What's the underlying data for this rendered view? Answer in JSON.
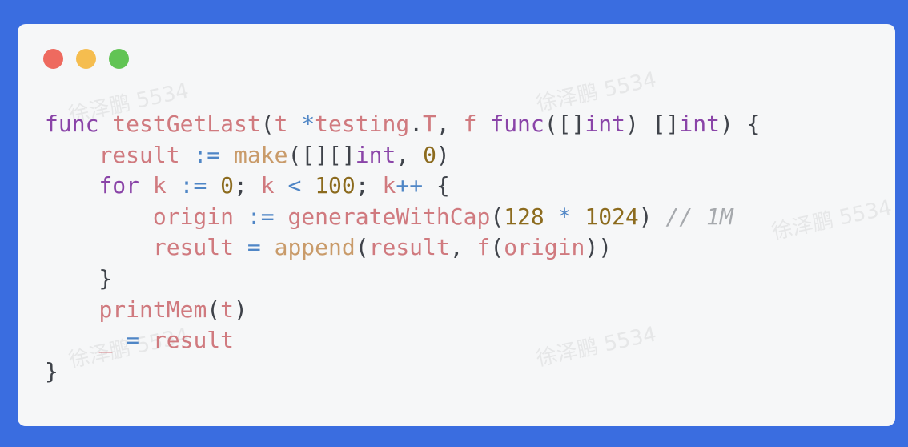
{
  "window": {
    "controls": [
      "close",
      "minimize",
      "maximize"
    ],
    "colors": {
      "close": "#ee6a5f",
      "minimize": "#f5bd4f",
      "maximize": "#61c454",
      "background": "#3a6de0",
      "card": "#f6f7f8"
    }
  },
  "watermark": "徐泽鹏 5534",
  "code": {
    "lines": [
      [
        [
          "kw",
          "func"
        ],
        [
          "pu",
          " "
        ],
        [
          "fn",
          "testGetLast"
        ],
        [
          "pu",
          "("
        ],
        [
          "id",
          "t"
        ],
        [
          "pu",
          " "
        ],
        [
          "op",
          "*"
        ],
        [
          "id",
          "testing"
        ],
        [
          "pu",
          "."
        ],
        [
          "id",
          "T"
        ],
        [
          "pu",
          ", "
        ],
        [
          "id",
          "f"
        ],
        [
          "pu",
          " "
        ],
        [
          "kw",
          "func"
        ],
        [
          "pu",
          "([]"
        ],
        [
          "kw",
          "int"
        ],
        [
          "pu",
          ") []"
        ],
        [
          "kw",
          "int"
        ],
        [
          "pu",
          ") {"
        ]
      ],
      [
        [
          "pu",
          "    "
        ],
        [
          "id",
          "result"
        ],
        [
          "pu",
          " "
        ],
        [
          "op",
          ":="
        ],
        [
          "pu",
          " "
        ],
        [
          "bi",
          "make"
        ],
        [
          "pu",
          "([][]"
        ],
        [
          "kw",
          "int"
        ],
        [
          "pu",
          ", "
        ],
        [
          "num",
          "0"
        ],
        [
          "pu",
          ")"
        ]
      ],
      [
        [
          "pu",
          "    "
        ],
        [
          "kw",
          "for"
        ],
        [
          "pu",
          " "
        ],
        [
          "id",
          "k"
        ],
        [
          "pu",
          " "
        ],
        [
          "op",
          ":="
        ],
        [
          "pu",
          " "
        ],
        [
          "num",
          "0"
        ],
        [
          "pu",
          "; "
        ],
        [
          "id",
          "k"
        ],
        [
          "pu",
          " "
        ],
        [
          "op",
          "<"
        ],
        [
          "pu",
          " "
        ],
        [
          "num",
          "100"
        ],
        [
          "pu",
          "; "
        ],
        [
          "id",
          "k"
        ],
        [
          "op",
          "++"
        ],
        [
          "pu",
          " {"
        ]
      ],
      [
        [
          "pu",
          "        "
        ],
        [
          "id",
          "origin"
        ],
        [
          "pu",
          " "
        ],
        [
          "op",
          ":="
        ],
        [
          "pu",
          " "
        ],
        [
          "fn",
          "generateWithCap"
        ],
        [
          "pu",
          "("
        ],
        [
          "num",
          "128"
        ],
        [
          "pu",
          " "
        ],
        [
          "op",
          "*"
        ],
        [
          "pu",
          " "
        ],
        [
          "num",
          "1024"
        ],
        [
          "pu",
          ") "
        ],
        [
          "cm",
          "// 1M"
        ]
      ],
      [
        [
          "pu",
          "        "
        ],
        [
          "id",
          "result"
        ],
        [
          "pu",
          " "
        ],
        [
          "op",
          "="
        ],
        [
          "pu",
          " "
        ],
        [
          "bi",
          "append"
        ],
        [
          "pu",
          "("
        ],
        [
          "id",
          "result"
        ],
        [
          "pu",
          ", "
        ],
        [
          "fn",
          "f"
        ],
        [
          "pu",
          "("
        ],
        [
          "id",
          "origin"
        ],
        [
          "pu",
          "))"
        ]
      ],
      [
        [
          "pu",
          "    }"
        ]
      ],
      [
        [
          "pu",
          "    "
        ],
        [
          "fn",
          "printMem"
        ],
        [
          "pu",
          "("
        ],
        [
          "id",
          "t"
        ],
        [
          "pu",
          ")"
        ]
      ],
      [
        [
          "pu",
          "    "
        ],
        [
          "id",
          "_"
        ],
        [
          "pu",
          " "
        ],
        [
          "op",
          "="
        ],
        [
          "pu",
          " "
        ],
        [
          "id",
          "result"
        ]
      ],
      [
        [
          "pu",
          "}"
        ]
      ]
    ]
  }
}
